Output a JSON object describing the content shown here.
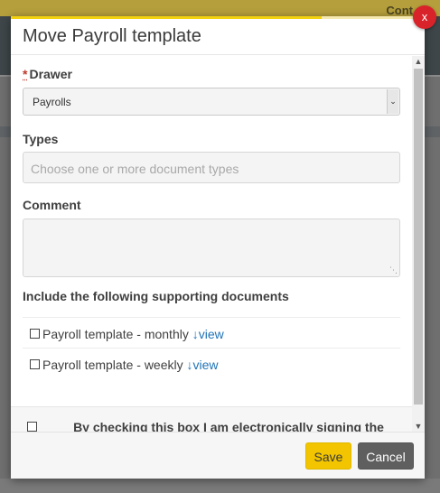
{
  "background": {
    "topbar_text": "Cont"
  },
  "modal": {
    "title": "Move Payroll template",
    "close_label": "x",
    "progress_fraction": 0.75
  },
  "form": {
    "drawer": {
      "required_mark": "*",
      "label": "Drawer",
      "value": "Payrolls"
    },
    "types": {
      "label": "Types",
      "placeholder": "Choose one or more document types"
    },
    "comment": {
      "label": "Comment",
      "value": ""
    },
    "supporting": {
      "heading": "Include the following supporting documents",
      "documents": [
        {
          "name": "Payroll template - monthly",
          "link": "↓view",
          "checked": false
        },
        {
          "name": "Payroll template - weekly",
          "link": "↓view",
          "checked": false
        }
      ]
    },
    "signature": {
      "text": "By checking this box I am electronically signing the attached document.",
      "checked": false
    }
  },
  "footer": {
    "save_label": "Save",
    "cancel_label": "Cancel"
  },
  "colors": {
    "accent": "#f2c500",
    "close": "#d9232a",
    "link": "#1f73b7",
    "cancel": "#5f5f5f"
  },
  "icons": {
    "select_arrow": "chevron-down-icon",
    "scroll_up": "scroll-up-arrow-icon",
    "scroll_down": "scroll-down-arrow-icon",
    "resize": "resize-grip-icon"
  }
}
